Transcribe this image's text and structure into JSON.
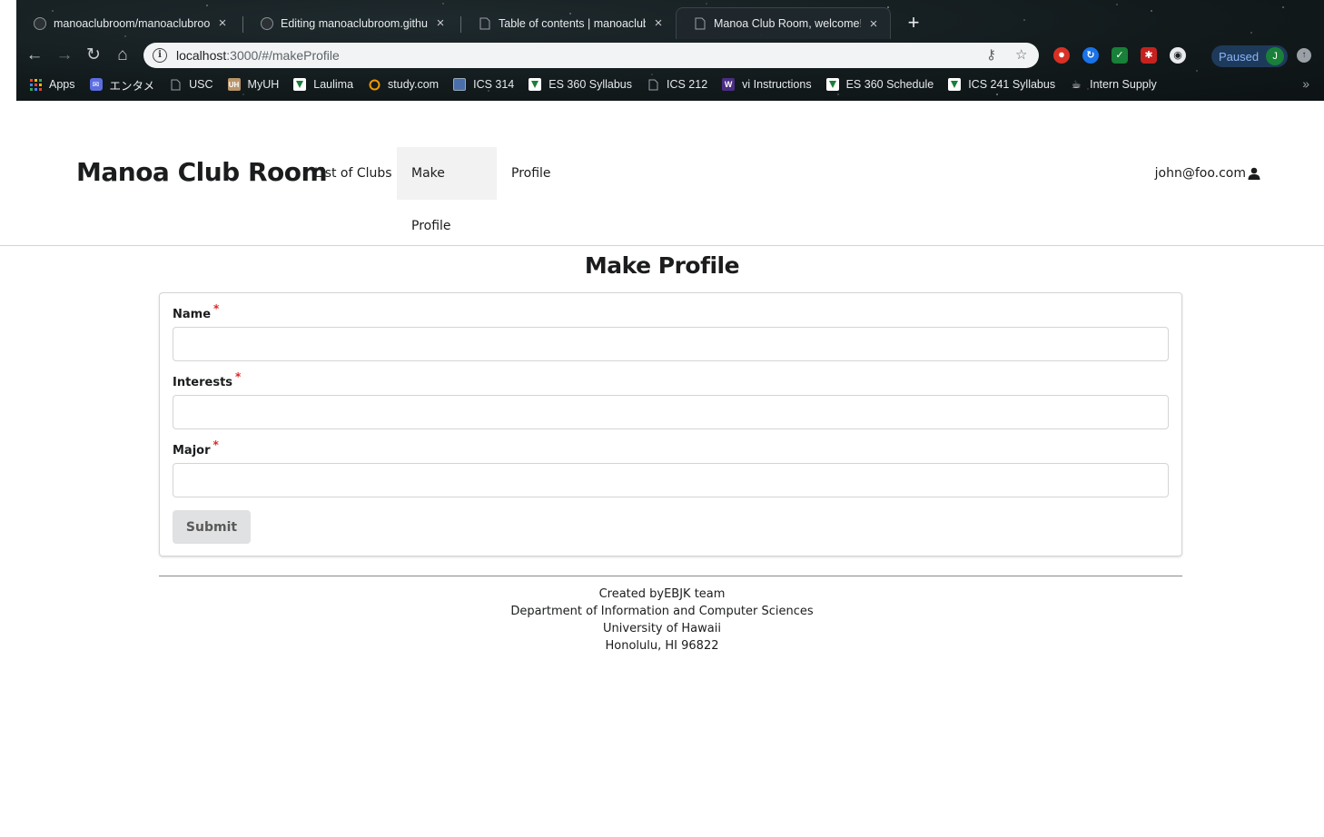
{
  "browser": {
    "tabs": [
      {
        "title": "manoaclubroom/manoaclubroom",
        "icon": "github-icon",
        "active": false
      },
      {
        "title": "Editing manoaclubroom.github.io",
        "icon": "github-icon",
        "active": false
      },
      {
        "title": "Table of contents | manoaclubroom",
        "icon": "page-icon",
        "active": false
      },
      {
        "title": "Manoa Club Room, welcome!!!",
        "icon": "page-icon",
        "active": true
      }
    ],
    "new_tab_label": "+",
    "url_host": "localhost",
    "url_rest": ":3000/#/makeProfile",
    "profile_status": "Paused",
    "profile_initial": "J",
    "bookmarks": [
      {
        "label": "Apps",
        "icon": "apps-grid-icon"
      },
      {
        "label": "エンタメ",
        "icon": "folder-icon"
      },
      {
        "label": "USC",
        "icon": "page-icon"
      },
      {
        "label": "MyUH",
        "icon": "uh-icon",
        "badge": "UH"
      },
      {
        "label": "Laulima",
        "icon": "bookmark-green-icon"
      },
      {
        "label": "study.com",
        "icon": "study-icon"
      },
      {
        "label": "ICS 314",
        "icon": "square-icon"
      },
      {
        "label": "ES 360 Syllabus",
        "icon": "bookmark-green-icon"
      },
      {
        "label": "ICS 212",
        "icon": "page-icon"
      },
      {
        "label": "vi Instructions",
        "icon": "w-icon",
        "badge": "W"
      },
      {
        "label": "ES 360 Schedule",
        "icon": "bookmark-green-icon"
      },
      {
        "label": "ICS 241 Syllabus",
        "icon": "bookmark-green-icon"
      },
      {
        "label": "Intern Supply",
        "icon": "cup-icon"
      }
    ],
    "bookmarks_more": "»",
    "colors": {
      "chrome_bg": "#121a1c",
      "omnibox_bg": "#f1f3f4"
    }
  },
  "navbar": {
    "brand": "Manoa Club Room",
    "items": [
      {
        "label": "List of Clubs",
        "active": false
      },
      {
        "label": "Make Profile",
        "active": true
      },
      {
        "label": "Profile",
        "active": false
      }
    ],
    "user": "john@foo.com"
  },
  "main": {
    "title": "Make Profile",
    "fields": [
      {
        "label": "Name",
        "required_mark": "*",
        "value": ""
      },
      {
        "label": "Interests",
        "required_mark": "*",
        "value": ""
      },
      {
        "label": "Major",
        "required_mark": "*",
        "value": ""
      }
    ],
    "submit_label": "Submit"
  },
  "footer": {
    "lines": [
      "Created byEBJK team",
      "Department of Information and Computer Sciences",
      "University of Hawaii",
      "Honolulu, HI 96822"
    ]
  },
  "colors": {
    "required": "#db2828",
    "active_nav_bg": "#f2f2f2",
    "button_bg": "#e0e1e2",
    "border": "#d4d4d5"
  }
}
